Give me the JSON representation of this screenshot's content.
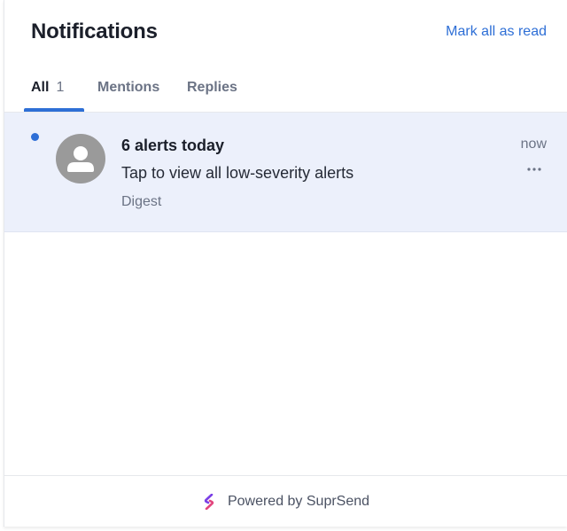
{
  "header": {
    "title": "Notifications",
    "mark_all_label": "Mark all as read"
  },
  "tabs": [
    {
      "label": "All",
      "count": "1",
      "active": true
    },
    {
      "label": "Mentions",
      "active": false
    },
    {
      "label": "Replies",
      "active": false
    }
  ],
  "notifications": [
    {
      "unread": true,
      "avatar_icon": "user-icon",
      "title": "6 alerts today",
      "body": "Tap to view all low-severity alerts",
      "tag": "Digest",
      "time": "now"
    }
  ],
  "footer": {
    "powered_by": "Powered by SuprSend",
    "brand_icon": "suprsend-logo-icon"
  },
  "colors": {
    "accent": "#2e6fd6",
    "unread_bg": "#ecf0fb",
    "avatar_bg": "#9a9a9a"
  }
}
